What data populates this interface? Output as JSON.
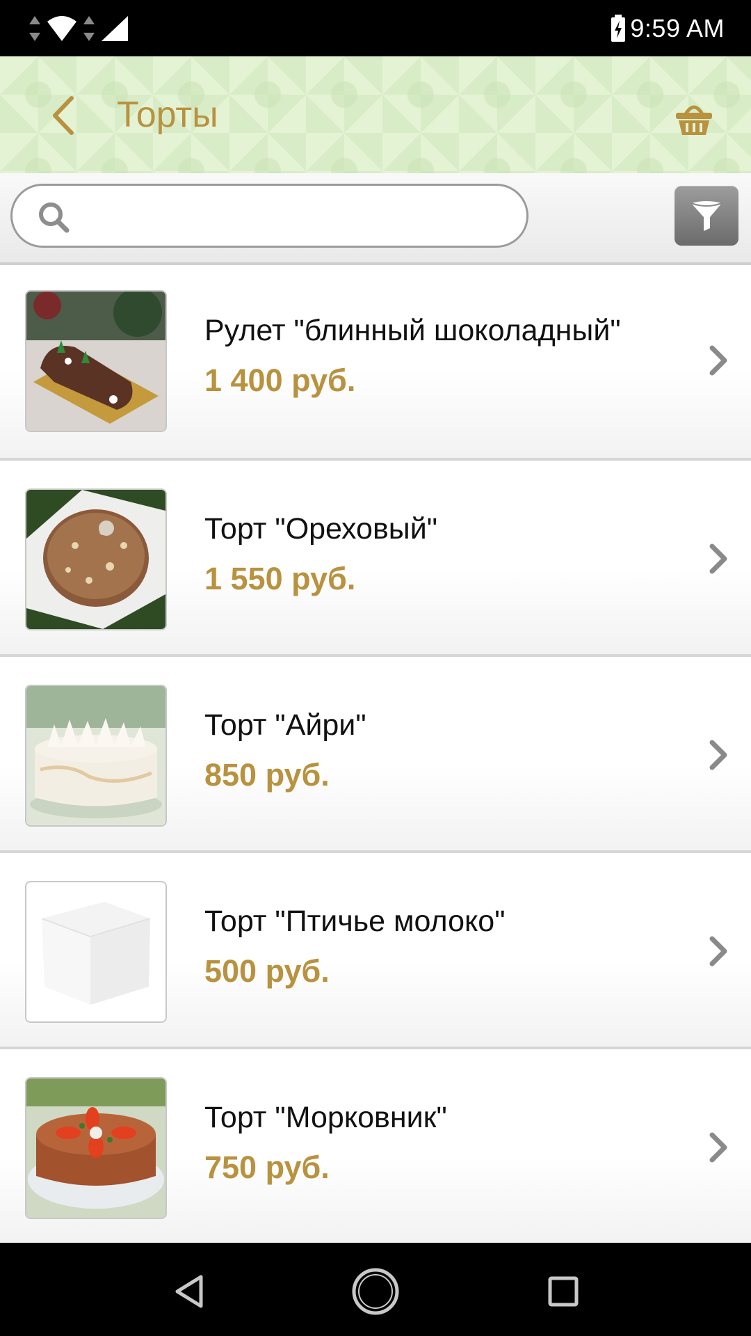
{
  "status_bar": {
    "time": "9:59 AM",
    "icons": [
      "data-arrows-icon",
      "wifi-icon",
      "signal-icon",
      "battery-charging-icon"
    ]
  },
  "toolbar": {
    "title": "Торты",
    "back_icon": "chevron-left-icon",
    "basket_icon": "basket-icon"
  },
  "search": {
    "value": "",
    "placeholder": "",
    "search_icon": "search-icon",
    "filter_icon": "filter-icon"
  },
  "products": [
    {
      "name": "Рулет \"блинный шоколадный\"",
      "price": "1 400 руб.",
      "image": "chocolate-roll-photo"
    },
    {
      "name": "Торт \"Ореховый\"",
      "price": "1 550 руб.",
      "image": "nut-cake-photo"
    },
    {
      "name": "Торт \"Айри\"",
      "price": "850 руб.",
      "image": "meringue-cake-photo"
    },
    {
      "name": "Торт \"Птичье молоко\"",
      "price": "500 руб.",
      "image": "white-box-placeholder"
    },
    {
      "name": "Торт \"Морковник\"",
      "price": "750 руб.",
      "image": "carrot-cake-photo"
    }
  ],
  "nav_bar": {
    "icons": [
      "nav-back-icon",
      "nav-home-icon",
      "nav-recents-icon"
    ]
  },
  "colors": {
    "accent": "#b8923f",
    "toolbar_bg": "#e4f3d4",
    "status_bar_bg": "#000000"
  }
}
